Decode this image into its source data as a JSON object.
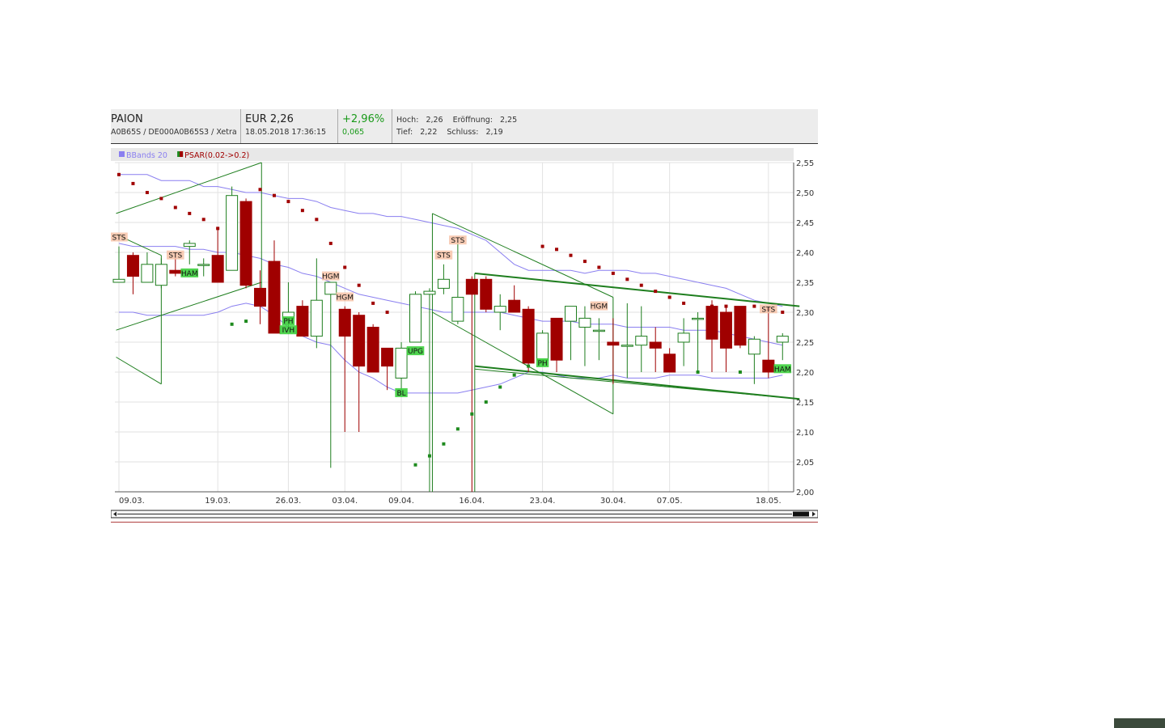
{
  "header": {
    "name": "PAION",
    "ids": "A0B65S / DE000A0B65S3 / Xetra",
    "price": "EUR 2,26",
    "datetime": "18.05.2018 17:36:15",
    "change_pct": "+2,96%",
    "change_abs": "0,065",
    "high_label": "Hoch:",
    "high": "2,26",
    "open_label": "Eröffnung:",
    "open": "2,25",
    "low_label": "Tief:",
    "low": "2,22",
    "close_label": "Schluss:",
    "close": "2,19"
  },
  "colors": {
    "up": "#1e7e1e",
    "down": "#a00000",
    "bbands": "#8a7ff0",
    "psar_up": "#1e8a1e",
    "psar_down": "#a00000",
    "trend": "#1e7e1e",
    "grid": "#e2e2e2"
  },
  "chart_data": {
    "type": "candlestick",
    "legend": [
      {
        "label": "BBands 20",
        "color": "#8a7ff0"
      },
      {
        "label": "PSAR(0.02->0.2)",
        "color": "#a00000"
      }
    ],
    "legend_placement": "top-left",
    "ylim": [
      2.0,
      2.55
    ],
    "yticks": [
      "2,55",
      "2,50",
      "2,45",
      "2,40",
      "2,35",
      "2,30",
      "2,25",
      "2,20",
      "2,15",
      "2,10",
      "2,05",
      "2,00"
    ],
    "xticks": [
      {
        "i": 0,
        "label": "09.03."
      },
      {
        "i": 7,
        "label": "19.03."
      },
      {
        "i": 12,
        "label": "26.03."
      },
      {
        "i": 16,
        "label": "03.04."
      },
      {
        "i": 20,
        "label": "09.04."
      },
      {
        "i": 25,
        "label": "16.04."
      },
      {
        "i": 30,
        "label": "23.04."
      },
      {
        "i": 35,
        "label": "30.04."
      },
      {
        "i": 39,
        "label": "07.05."
      },
      {
        "i": 46,
        "label": "18.05."
      }
    ],
    "candles": [
      {
        "o": 2.35,
        "h": 2.41,
        "l": 2.35,
        "c": 2.355
      },
      {
        "o": 2.395,
        "h": 2.4,
        "l": 2.33,
        "c": 2.36
      },
      {
        "o": 2.35,
        "h": 2.4,
        "l": 2.35,
        "c": 2.38
      },
      {
        "o": 2.345,
        "h": 2.39,
        "l": 2.34,
        "c": 2.38
      },
      {
        "o": 2.37,
        "h": 2.4,
        "l": 2.36,
        "c": 2.365
      },
      {
        "o": 2.41,
        "h": 2.42,
        "l": 2.38,
        "c": 2.415
      },
      {
        "o": 2.38,
        "h": 2.39,
        "l": 2.36,
        "c": 2.38
      },
      {
        "o": 2.395,
        "h": 2.44,
        "l": 2.35,
        "c": 2.35
      },
      {
        "o": 2.37,
        "h": 2.51,
        "l": 2.37,
        "c": 2.495
      },
      {
        "o": 2.485,
        "h": 2.49,
        "l": 2.34,
        "c": 2.345
      },
      {
        "o": 2.34,
        "h": 2.37,
        "l": 2.28,
        "c": 2.31
      },
      {
        "o": 2.385,
        "h": 2.42,
        "l": 2.27,
        "c": 2.265
      },
      {
        "o": 2.29,
        "h": 2.35,
        "l": 2.27,
        "c": 2.3
      },
      {
        "o": 2.31,
        "h": 2.32,
        "l": 2.26,
        "c": 2.26
      },
      {
        "o": 2.26,
        "h": 2.39,
        "l": 2.24,
        "c": 2.32
      },
      {
        "o": 2.33,
        "h": 2.35,
        "l": 2.04,
        "c": 2.35
      },
      {
        "o": 2.305,
        "h": 2.31,
        "l": 2.1,
        "c": 2.26
      },
      {
        "o": 2.295,
        "h": 2.3,
        "l": 2.1,
        "c": 2.21
      },
      {
        "o": 2.275,
        "h": 2.28,
        "l": 2.2,
        "c": 2.2
      },
      {
        "o": 2.24,
        "h": 2.24,
        "l": 2.17,
        "c": 2.21
      },
      {
        "o": 2.19,
        "h": 2.25,
        "l": 2.17,
        "c": 2.24
      },
      {
        "o": 2.25,
        "h": 2.335,
        "l": 2.25,
        "c": 2.33
      },
      {
        "o": 2.33,
        "h": 2.34,
        "l": 2.0,
        "c": 2.335
      },
      {
        "o": 2.34,
        "h": 2.38,
        "l": 2.33,
        "c": 2.355
      },
      {
        "o": 2.285,
        "h": 2.42,
        "l": 2.28,
        "c": 2.325
      },
      {
        "o": 2.355,
        "h": 2.36,
        "l": 2.0,
        "c": 2.33
      },
      {
        "o": 2.355,
        "h": 2.36,
        "l": 2.3,
        "c": 2.305
      },
      {
        "o": 2.3,
        "h": 2.33,
        "l": 2.27,
        "c": 2.31
      },
      {
        "o": 2.32,
        "h": 2.345,
        "l": 2.3,
        "c": 2.3
      },
      {
        "o": 2.305,
        "h": 2.31,
        "l": 2.2,
        "c": 2.215
      },
      {
        "o": 2.22,
        "h": 2.27,
        "l": 2.21,
        "c": 2.265
      },
      {
        "o": 2.29,
        "h": 2.29,
        "l": 2.2,
        "c": 2.22
      },
      {
        "o": 2.285,
        "h": 2.31,
        "l": 2.22,
        "c": 2.31
      },
      {
        "o": 2.275,
        "h": 2.31,
        "l": 2.21,
        "c": 2.29
      },
      {
        "o": 2.27,
        "h": 2.29,
        "l": 2.22,
        "c": 2.27
      },
      {
        "o": 2.25,
        "h": 2.29,
        "l": 2.18,
        "c": 2.245
      },
      {
        "o": 2.245,
        "h": 2.315,
        "l": 2.19,
        "c": 2.245
      },
      {
        "o": 2.245,
        "h": 2.31,
        "l": 2.2,
        "c": 2.26
      },
      {
        "o": 2.25,
        "h": 2.275,
        "l": 2.2,
        "c": 2.24
      },
      {
        "o": 2.23,
        "h": 2.24,
        "l": 2.2,
        "c": 2.2
      },
      {
        "o": 2.25,
        "h": 2.29,
        "l": 2.21,
        "c": 2.265
      },
      {
        "o": 2.29,
        "h": 2.3,
        "l": 2.2,
        "c": 2.29
      },
      {
        "o": 2.31,
        "h": 2.32,
        "l": 2.2,
        "c": 2.255
      },
      {
        "o": 2.3,
        "h": 2.31,
        "l": 2.2,
        "c": 2.24
      },
      {
        "o": 2.31,
        "h": 2.31,
        "l": 2.24,
        "c": 2.245
      },
      {
        "o": 2.23,
        "h": 2.26,
        "l": 2.18,
        "c": 2.255
      },
      {
        "o": 2.22,
        "h": 2.3,
        "l": 2.19,
        "c": 2.2
      },
      {
        "o": 2.25,
        "h": 2.265,
        "l": 2.22,
        "c": 2.26
      }
    ],
    "bb_upper": [
      2.53,
      2.53,
      2.53,
      2.52,
      2.52,
      2.52,
      2.51,
      2.51,
      2.505,
      2.5,
      2.5,
      2.495,
      2.49,
      2.49,
      2.485,
      2.475,
      2.47,
      2.465,
      2.465,
      2.46,
      2.46,
      2.455,
      2.45,
      2.445,
      2.44,
      2.43,
      2.42,
      2.4,
      2.38,
      2.37,
      2.37,
      2.37,
      2.37,
      2.365,
      2.37,
      2.37,
      2.37,
      2.365,
      2.365,
      2.36,
      2.355,
      2.35,
      2.345,
      2.34,
      2.33,
      2.32,
      2.315,
      2.31
    ],
    "bb_mid": [
      2.415,
      2.41,
      2.41,
      2.41,
      2.41,
      2.405,
      2.405,
      2.4,
      2.4,
      2.395,
      2.39,
      2.38,
      2.375,
      2.365,
      2.36,
      2.35,
      2.34,
      2.33,
      2.325,
      2.32,
      2.315,
      2.31,
      2.305,
      2.3,
      2.3,
      2.3,
      2.3,
      2.3,
      2.295,
      2.29,
      2.285,
      2.285,
      2.285,
      2.28,
      2.28,
      2.28,
      2.275,
      2.275,
      2.275,
      2.275,
      2.27,
      2.27,
      2.27,
      2.265,
      2.26,
      2.255,
      2.25,
      2.245
    ],
    "bb_lower": [
      2.3,
      2.3,
      2.295,
      2.295,
      2.295,
      2.295,
      2.295,
      2.3,
      2.31,
      2.315,
      2.31,
      2.295,
      2.275,
      2.26,
      2.25,
      2.245,
      2.22,
      2.2,
      2.19,
      2.175,
      2.165,
      2.165,
      2.165,
      2.165,
      2.165,
      2.17,
      2.175,
      2.18,
      2.19,
      2.2,
      2.2,
      2.195,
      2.19,
      2.19,
      2.19,
      2.195,
      2.19,
      2.19,
      2.19,
      2.195,
      2.195,
      2.195,
      2.19,
      2.19,
      2.19,
      2.19,
      2.19,
      2.195
    ],
    "psar": [
      {
        "i": 0,
        "v": 2.53,
        "t": "down"
      },
      {
        "i": 1,
        "v": 2.515,
        "t": "down"
      },
      {
        "i": 2,
        "v": 2.5,
        "t": "down"
      },
      {
        "i": 3,
        "v": 2.49,
        "t": "down"
      },
      {
        "i": 4,
        "v": 2.475,
        "t": "down"
      },
      {
        "i": 5,
        "v": 2.465,
        "t": "down"
      },
      {
        "i": 6,
        "v": 2.455,
        "t": "down"
      },
      {
        "i": 7,
        "v": 2.44,
        "t": "down"
      },
      {
        "i": 8,
        "v": 2.28,
        "t": "up"
      },
      {
        "i": 9,
        "v": 2.285,
        "t": "up"
      },
      {
        "i": 10,
        "v": 2.505,
        "t": "down"
      },
      {
        "i": 11,
        "v": 2.495,
        "t": "down"
      },
      {
        "i": 12,
        "v": 2.485,
        "t": "down"
      },
      {
        "i": 13,
        "v": 2.47,
        "t": "down"
      },
      {
        "i": 14,
        "v": 2.455,
        "t": "down"
      },
      {
        "i": 15,
        "v": 2.415,
        "t": "down"
      },
      {
        "i": 16,
        "v": 2.375,
        "t": "down"
      },
      {
        "i": 17,
        "v": 2.345,
        "t": "down"
      },
      {
        "i": 18,
        "v": 2.315,
        "t": "down"
      },
      {
        "i": 19,
        "v": 2.3,
        "t": "down"
      },
      {
        "i": 21,
        "v": 2.045,
        "t": "up"
      },
      {
        "i": 22,
        "v": 2.06,
        "t": "up"
      },
      {
        "i": 23,
        "v": 2.08,
        "t": "up"
      },
      {
        "i": 24,
        "v": 2.105,
        "t": "up"
      },
      {
        "i": 25,
        "v": 2.13,
        "t": "up"
      },
      {
        "i": 26,
        "v": 2.15,
        "t": "up"
      },
      {
        "i": 27,
        "v": 2.175,
        "t": "up"
      },
      {
        "i": 28,
        "v": 2.195,
        "t": "up"
      },
      {
        "i": 29,
        "v": 2.21,
        "t": "up"
      },
      {
        "i": 30,
        "v": 2.41,
        "t": "down"
      },
      {
        "i": 31,
        "v": 2.405,
        "t": "down"
      },
      {
        "i": 32,
        "v": 2.395,
        "t": "down"
      },
      {
        "i": 33,
        "v": 2.385,
        "t": "down"
      },
      {
        "i": 34,
        "v": 2.375,
        "t": "down"
      },
      {
        "i": 35,
        "v": 2.365,
        "t": "down"
      },
      {
        "i": 36,
        "v": 2.355,
        "t": "down"
      },
      {
        "i": 37,
        "v": 2.345,
        "t": "down"
      },
      {
        "i": 38,
        "v": 2.335,
        "t": "down"
      },
      {
        "i": 39,
        "v": 2.325,
        "t": "down"
      },
      {
        "i": 40,
        "v": 2.315,
        "t": "down"
      },
      {
        "i": 41,
        "v": 2.2,
        "t": "up"
      },
      {
        "i": 42,
        "v": 2.31,
        "t": "down"
      },
      {
        "i": 43,
        "v": 2.31,
        "t": "down"
      },
      {
        "i": 44,
        "v": 2.2,
        "t": "up"
      },
      {
        "i": 45,
        "v": 2.31,
        "t": "down"
      },
      {
        "i": 46,
        "v": 2.305,
        "t": "down"
      },
      {
        "i": 47,
        "v": 2.3,
        "t": "down"
      }
    ],
    "patterns": [
      {
        "i": 0,
        "v": 2.425,
        "label": "STS",
        "kind": "bear"
      },
      {
        "i": 4,
        "v": 2.395,
        "label": "STS",
        "kind": "bear"
      },
      {
        "i": 5,
        "v": 2.365,
        "label": "HAM",
        "kind": "bull"
      },
      {
        "i": 12,
        "v": 2.285,
        "label": "PH",
        "kind": "bull"
      },
      {
        "i": 12,
        "v": 2.27,
        "label": "IVH",
        "kind": "bull"
      },
      {
        "i": 15,
        "v": 2.36,
        "label": "HGM",
        "kind": "bear"
      },
      {
        "i": 16,
        "v": 2.325,
        "label": "HGM",
        "kind": "bear"
      },
      {
        "i": 20,
        "v": 2.165,
        "label": "BL",
        "kind": "bull"
      },
      {
        "i": 21,
        "v": 2.235,
        "label": "UPG",
        "kind": "bull"
      },
      {
        "i": 23,
        "v": 2.395,
        "label": "STS",
        "kind": "bear"
      },
      {
        "i": 24,
        "v": 2.42,
        "label": "STS",
        "kind": "bear"
      },
      {
        "i": 30,
        "v": 2.215,
        "label": "PH",
        "kind": "bull"
      },
      {
        "i": 34,
        "v": 2.31,
        "label": "HGM",
        "kind": "bear"
      },
      {
        "i": 46,
        "v": 2.305,
        "label": "STS",
        "kind": "bear"
      },
      {
        "i": 47,
        "v": 2.205,
        "label": "HAM",
        "kind": "bull"
      }
    ],
    "trendlines": [
      {
        "a": [
          -0.2,
          2.465
        ],
        "b": [
          10.1,
          2.55
        ],
        "w": 1
      },
      {
        "a": [
          -0.2,
          2.27
        ],
        "b": [
          10.1,
          2.35
        ],
        "w": 1
      },
      {
        "a": [
          10.1,
          2.55
        ],
        "b": [
          10.1,
          2.34
        ],
        "w": 1
      },
      {
        "a": [
          -0.2,
          2.43
        ],
        "b": [
          3.0,
          2.395
        ],
        "w": 1
      },
      {
        "a": [
          3.0,
          2.395
        ],
        "b": [
          3.0,
          2.18
        ],
        "w": 1
      },
      {
        "a": [
          -0.2,
          2.225
        ],
        "b": [
          3.0,
          2.18
        ],
        "w": 1
      },
      {
        "a": [
          22.2,
          2.465
        ],
        "b": [
          35.0,
          2.325
        ],
        "w": 1
      },
      {
        "a": [
          22.2,
          2.465
        ],
        "b": [
          22.2,
          2.0
        ],
        "w": 1
      },
      {
        "a": [
          22.2,
          2.3
        ],
        "b": [
          35.0,
          2.13
        ],
        "w": 1
      },
      {
        "a": [
          35.0,
          2.325
        ],
        "b": [
          35.0,
          2.13
        ],
        "w": 1
      },
      {
        "a": [
          25.2,
          2.365
        ],
        "b": [
          48.2,
          2.31
        ],
        "w": 2
      },
      {
        "a": [
          25.2,
          2.21
        ],
        "b": [
          48.2,
          2.155
        ],
        "w": 2
      },
      {
        "a": [
          25.2,
          2.205
        ],
        "b": [
          48.2,
          2.155
        ],
        "w": 1
      },
      {
        "a": [
          25.2,
          2.365
        ],
        "b": [
          25.2,
          2.0
        ],
        "w": 1
      }
    ]
  }
}
